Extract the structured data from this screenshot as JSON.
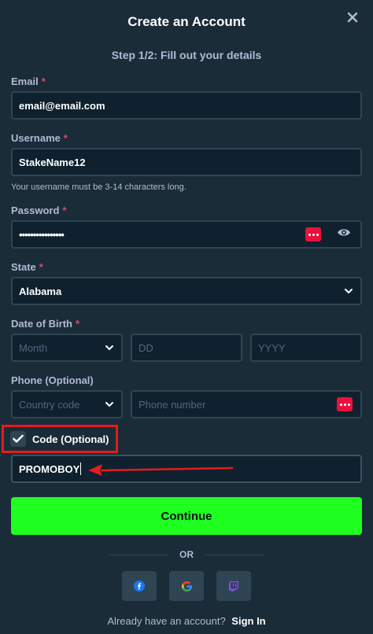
{
  "dialog": {
    "title": "Create an Account",
    "step": "Step 1/2: Fill out your details"
  },
  "email": {
    "label": "Email",
    "required_mark": "*",
    "value": "email@email.com"
  },
  "username": {
    "label": "Username",
    "required_mark": "*",
    "value": "StakeName12",
    "hint": "Your username must be 3-14 characters long."
  },
  "password": {
    "label": "Password",
    "required_mark": "*",
    "value": "••••••••••••••••"
  },
  "state": {
    "label": "State",
    "required_mark": "*",
    "value": "Alabama"
  },
  "dob": {
    "label": "Date of Birth",
    "required_mark": "*",
    "month_placeholder": "Month",
    "day_placeholder": "DD",
    "year_placeholder": "YYYY"
  },
  "phone": {
    "label": "Phone (Optional)",
    "country_placeholder": "Country code",
    "number_placeholder": "Phone number"
  },
  "code": {
    "label": "Code (Optional)",
    "value": "PROMOBOY",
    "checked": true
  },
  "actions": {
    "continue_label": "Continue",
    "or_label": "OR"
  },
  "signin": {
    "prompt": "Already have an account?",
    "link": "Sign In"
  },
  "colors": {
    "background": "#1a2c38",
    "input_bg": "#0f212e",
    "border": "#2f4553",
    "accent_green": "#1fff20",
    "highlight_red": "#e61b1b"
  },
  "icons": [
    "close-icon",
    "eye-icon",
    "password-manager-icon",
    "chevron-down-icon",
    "check-icon",
    "facebook-icon",
    "google-icon",
    "twitch-icon"
  ]
}
